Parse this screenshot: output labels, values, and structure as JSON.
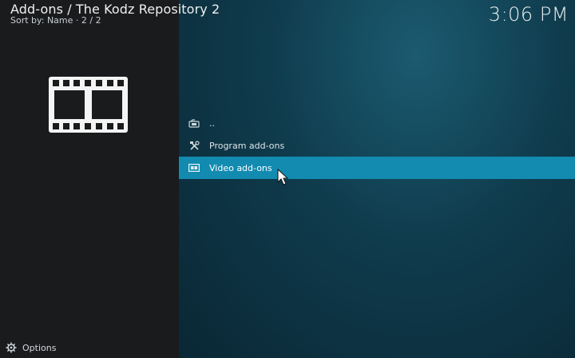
{
  "header": {
    "title": "Add-ons / The Kodz Repository 2",
    "sort_info": "Sort by: Name  ·  2 / 2",
    "clock": "3:06 PM"
  },
  "preview": {
    "icon": "film-strip-icon"
  },
  "list": {
    "items": [
      {
        "label": "..",
        "icon": "parent-folder-icon",
        "focused": false
      },
      {
        "label": "Program add-ons",
        "icon": "tools-icon",
        "focused": false
      },
      {
        "label": "Video add-ons",
        "icon": "film-icon",
        "focused": true
      }
    ]
  },
  "footer": {
    "options_label": "Options",
    "icon": "gear-icon"
  },
  "colors": {
    "accent": "#138bb1",
    "left_panel_bg": "#1a1b1d",
    "main_bg": "#0f3b4c"
  }
}
